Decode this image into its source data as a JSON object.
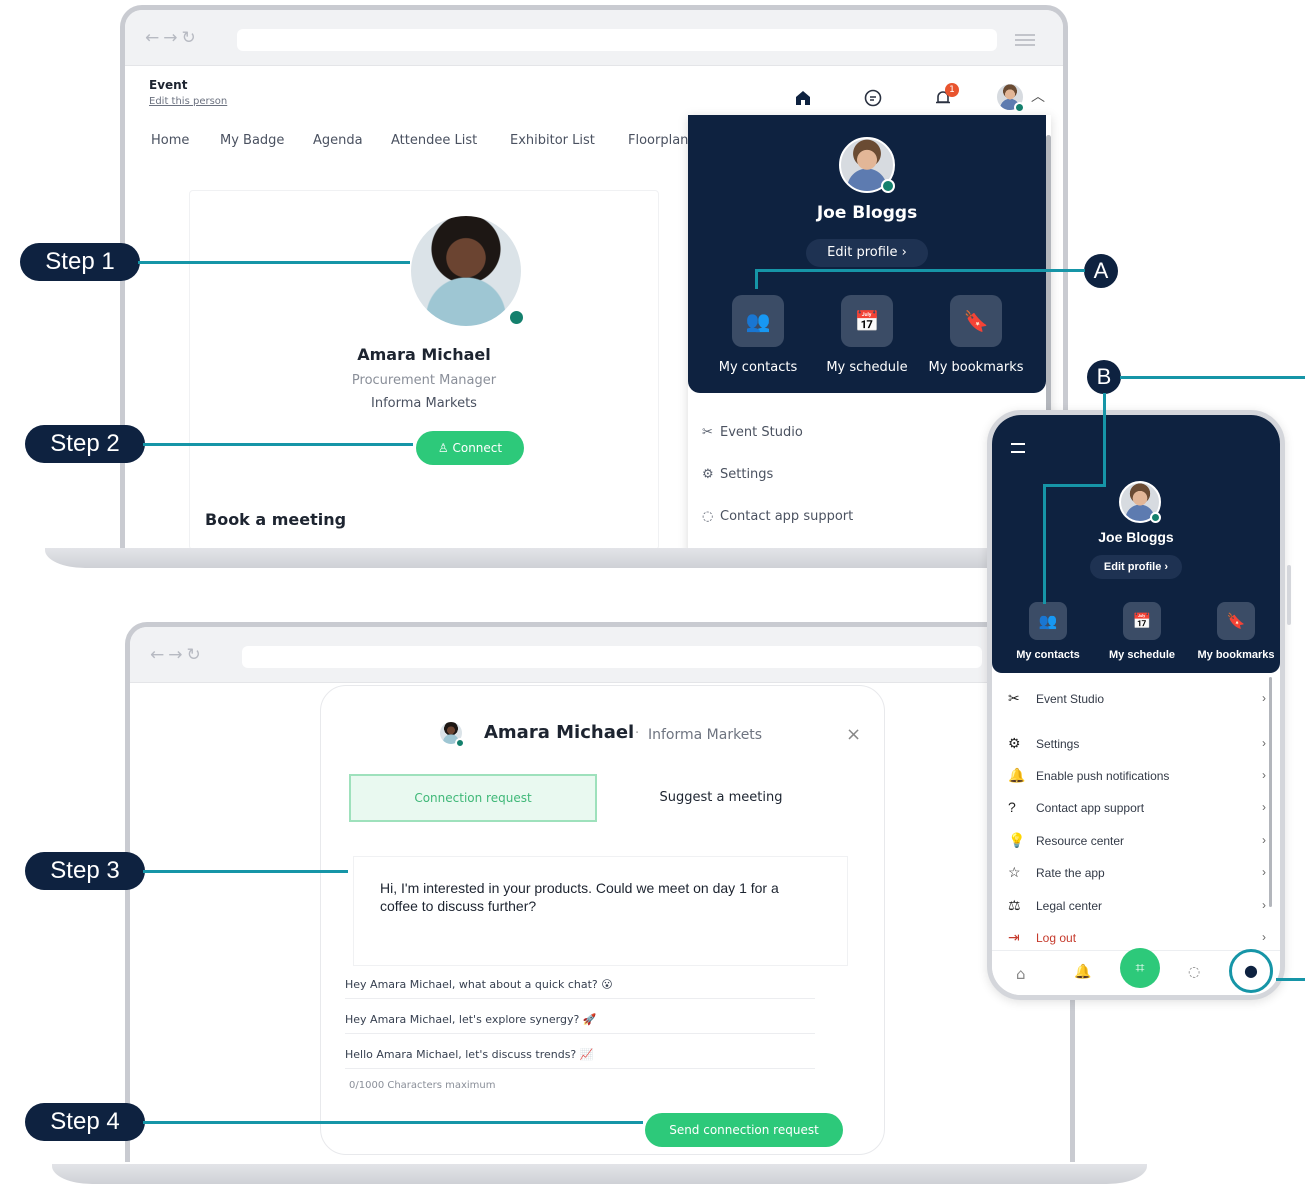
{
  "steps": {
    "step1": "Step 1",
    "step2": "Step 2",
    "step3": "Step 3",
    "step4": "Step 4"
  },
  "markers": {
    "a": "A",
    "b": "B"
  },
  "desktop": {
    "event_label": "Event",
    "edit_person": "Edit this person",
    "header_icons": [
      "home-icon",
      "chat-icon",
      "bell-icon"
    ],
    "notification_count": "1",
    "tabs": [
      "Home",
      "My Badge",
      "Agenda",
      "Attendee List",
      "Exhibitor List",
      "Floorplan"
    ],
    "profile": {
      "name": "Amara Michael",
      "title": "Procurement Manager",
      "company": "Informa Markets",
      "connect_label": "Connect"
    },
    "book_meeting": "Book a meeting",
    "dropdown": {
      "user_name": "Joe Bloggs",
      "edit_profile": "Edit profile",
      "tiles": [
        "My contacts",
        "My schedule",
        "My bookmarks"
      ],
      "menu": [
        "Event Studio",
        "Settings",
        "Contact app support"
      ]
    }
  },
  "modal": {
    "name": "Amara Michael",
    "company": "Informa Markets",
    "tab_connection": "Connection request",
    "tab_meeting": "Suggest a meeting",
    "message": "Hi, I'm interested in your products. Could we meet on day 1 for a coffee to discuss further?",
    "suggestions": [
      "Hey Amara Michael, what about a quick chat? 😮",
      "Hey Amara Michael, let's explore synergy? 🚀",
      "Hello Amara Michael, let's discuss trends? 📈"
    ],
    "char_limit": "0/1000 Characters maximum",
    "send_label": "Send connection request"
  },
  "mobile": {
    "user_name": "Joe Bloggs",
    "edit_profile": "Edit profile",
    "tiles": [
      "My contacts",
      "My schedule",
      "My bookmarks"
    ],
    "menu": [
      "Event Studio",
      "Settings",
      "Enable push notifications",
      "Contact app support",
      "Resource center",
      "Rate the app",
      "Legal center",
      "Log out"
    ],
    "bottom_nav": [
      "home-icon",
      "bell-icon",
      "qr-scan-icon",
      "chat-icon",
      "profile-icon"
    ]
  },
  "colors": {
    "navy": "#0e2240",
    "teal_line": "#1695a7",
    "green": "#2dc97a",
    "logout_red": "#c63a2c"
  }
}
